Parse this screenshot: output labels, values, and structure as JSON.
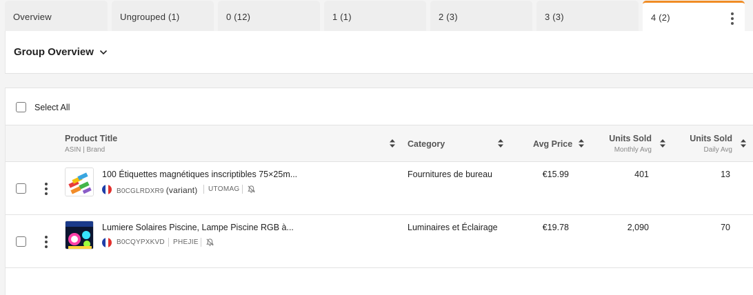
{
  "tabs": [
    {
      "label": "Overview",
      "active": false
    },
    {
      "label": "Ungrouped  (1)",
      "active": false
    },
    {
      "label": "0  (12)",
      "active": false
    },
    {
      "label": "1  (1)",
      "active": false
    },
    {
      "label": "2  (3)",
      "active": false
    },
    {
      "label": "3  (3)",
      "active": false
    },
    {
      "label": "4  (2)",
      "active": true
    }
  ],
  "colors": {
    "accent": "#f08c24",
    "tab_bg": "#eeeeee",
    "panel_bg": "#ffffff",
    "header_bg": "#f6f6f6"
  },
  "group": {
    "title": "Group Overview",
    "icon": "chevron-down-icon"
  },
  "select_all": {
    "label": "Select All",
    "checked": false
  },
  "columns": {
    "product": {
      "title": "Product Title",
      "sub": "ASIN | Brand"
    },
    "category": {
      "title": "Category"
    },
    "avg_price": {
      "title": "Avg Price"
    },
    "units_monthly": {
      "title": "Units Sold",
      "sub": "Monthly Avg"
    },
    "units_daily": {
      "title": "Units Sold",
      "sub": "Daily Avg"
    }
  },
  "rows": [
    {
      "title": "100 Étiquettes magnétiques inscriptibles 75×25m...",
      "asin": "B0CGLRDXR9",
      "variant": "(variant)",
      "brand": "UTOMAG",
      "country_flag": "france-flag-icon",
      "category": "Fournitures de bureau",
      "avg_price": "€15.99",
      "units_monthly": "401",
      "units_daily": "13"
    },
    {
      "title": "Lumiere Solaires Piscine, Lampe Piscine RGB à...",
      "asin": "B0CQYPXKVD",
      "variant": "",
      "brand": "PHEJIE",
      "country_flag": "france-flag-icon",
      "category": "Luminaires et Éclairage",
      "avg_price": "€19.78",
      "units_monthly": "2,090",
      "units_daily": "70"
    }
  ]
}
